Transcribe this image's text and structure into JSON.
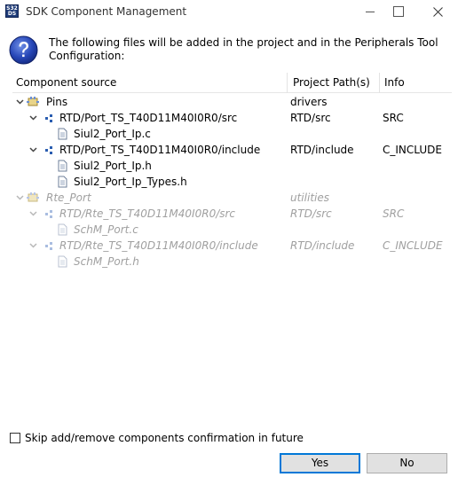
{
  "window": {
    "title": "SDK Component Management",
    "app_icon_text_top": "S32",
    "app_icon_text_bottom": "DS"
  },
  "message": "The following files will be added in the project and in the Peripherals Tool Configuration:",
  "table": {
    "headers": {
      "component_source": "Component source",
      "project_paths": "Project Path(s)",
      "info": "Info"
    },
    "rows": [
      {
        "name": "Pins",
        "path": "drivers",
        "info": ""
      },
      {
        "name": "RTD/Port_TS_T40D11M40I0R0/src",
        "path": "RTD/src",
        "info": "SRC"
      },
      {
        "name": "Siul2_Port_Ip.c",
        "path": "",
        "info": ""
      },
      {
        "name": "RTD/Port_TS_T40D11M40I0R0/include",
        "path": "RTD/include",
        "info": "C_INCLUDE"
      },
      {
        "name": "Siul2_Port_Ip.h",
        "path": "",
        "info": ""
      },
      {
        "name": "Siul2_Port_Ip_Types.h",
        "path": "",
        "info": ""
      },
      {
        "name": "Rte_Port",
        "path": "utilities",
        "info": ""
      },
      {
        "name": "RTD/Rte_TS_T40D11M40I0R0/src",
        "path": "RTD/src",
        "info": "SRC"
      },
      {
        "name": "SchM_Port.c",
        "path": "",
        "info": ""
      },
      {
        "name": "RTD/Rte_TS_T40D11M40I0R0/include",
        "path": "RTD/include",
        "info": "C_INCLUDE"
      },
      {
        "name": "SchM_Port.h",
        "path": "",
        "info": ""
      }
    ]
  },
  "skip_checkbox": {
    "label": "Skip add/remove components confirmation in future",
    "checked": false
  },
  "buttons": {
    "yes": "Yes",
    "no": "No"
  },
  "colors": {
    "accent": "#0078d7",
    "disabled_text": "#a0a0a0",
    "folder_blue": "#2a5db0"
  }
}
